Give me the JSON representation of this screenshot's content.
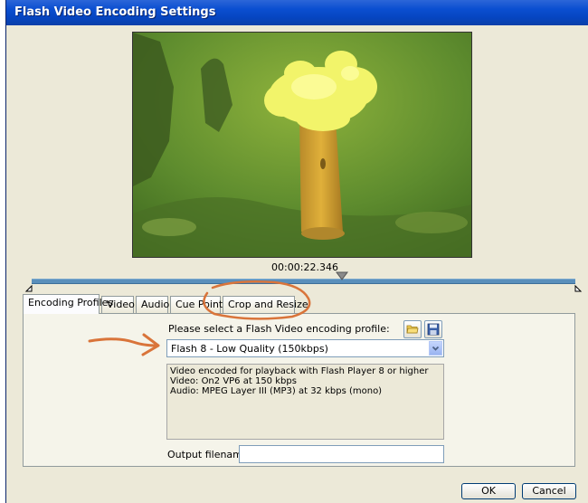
{
  "window": {
    "title": "Flash Video Encoding Settings"
  },
  "preview": {
    "timecode": "00:00:22.346"
  },
  "tabs": [
    {
      "label": "Encoding Profiles",
      "active": true
    },
    {
      "label": "Video"
    },
    {
      "label": "Audio"
    },
    {
      "label": "Cue Points"
    },
    {
      "label": "Crop and Resize"
    }
  ],
  "profile": {
    "prompt": "Please select a Flash Video encoding profile:",
    "selected": "Flash 8 - Low Quality (150kbps)",
    "description_lines": [
      "Video encoded for playback with Flash Player 8 or higher",
      "Video: On2 VP6 at 150 kbps",
      "Audio: MPEG Layer III (MP3) at 32 kbps (mono)"
    ],
    "output_label": "Output filename:",
    "output_value": ""
  },
  "buttons": {
    "ok": "OK",
    "cancel": "Cancel"
  },
  "colors": {
    "annotation": "#d9743a",
    "titlebar": "#0b4fd1"
  }
}
